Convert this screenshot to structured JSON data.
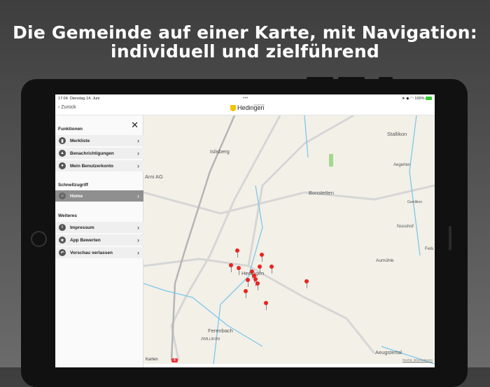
{
  "headline": {
    "line1": "Die Gemeinde auf einer Karte, mit Navigation:",
    "line2": "individuell und zielführend"
  },
  "status": {
    "time": "17:04",
    "date": "Dienstag 14. Juni",
    "dots": "•••",
    "battery": "100%"
  },
  "nav": {
    "back": "Zurück",
    "logo": "Hedingen",
    "logo_small": "GEMEINDE"
  },
  "sidebar": {
    "close_icon": "close-icon",
    "sections": [
      {
        "title": "Funktionen",
        "items": [
          {
            "label": "Merkliste",
            "icon": "bookmark-icon"
          },
          {
            "label": "Benachrichtigungen",
            "icon": "bell-icon"
          },
          {
            "label": "Mein Benutzerkonto",
            "icon": "user-icon"
          }
        ]
      },
      {
        "title": "Schnellzugriff",
        "items": [
          {
            "label": "Home",
            "icon": "home-icon",
            "active": true
          }
        ]
      },
      {
        "title": "Weiteres",
        "items": [
          {
            "label": "Impressum",
            "icon": "info-icon"
          },
          {
            "label": "App Bewerten",
            "icon": "star-icon"
          },
          {
            "label": "Vorschau verlassen",
            "icon": "back-arrow-icon"
          }
        ]
      }
    ]
  },
  "map": {
    "labels": [
      "Islisberg",
      "Stallikon",
      "Arni AG",
      "Aegerten",
      "Bonstetten",
      "Gamlikon",
      "Nusshof",
      "Fels",
      "Aumühle",
      "Hedingen",
      "Ferenbach",
      "ZWILLIKON",
      "Aeugstertal"
    ],
    "attribution": "Karten",
    "legal": "Rechtl. Informationen",
    "road_badge": "4"
  },
  "colors": {
    "accent": "#f3c300",
    "pin": "#e8241f"
  }
}
